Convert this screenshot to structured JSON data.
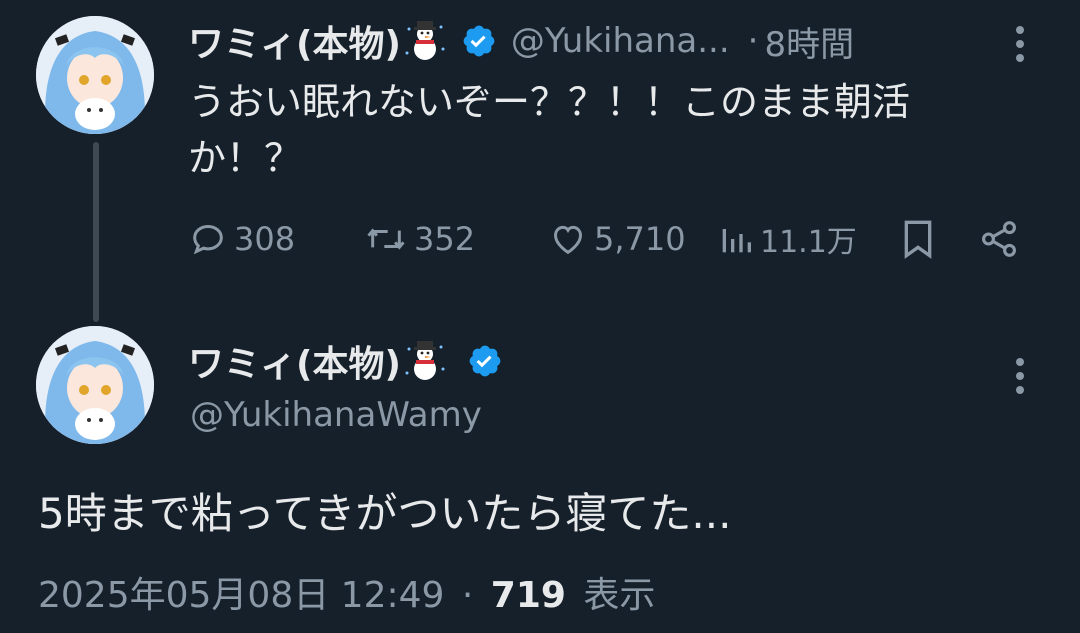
{
  "colors": {
    "background": "#15202b",
    "text": "#e7e9ea",
    "muted": "#8b98a5",
    "verified": "#1d9bf0",
    "thread_line": "#3e4954"
  },
  "tweet1": {
    "display_name": "ワミィ(本物)",
    "name_emoji": "snowman-icon",
    "handle": "@Yukihana...",
    "separator": "·",
    "time": "8時間",
    "text": "うおい眠れないぞー？？！！このまま朝活か！？",
    "actions": {
      "replies": "308",
      "retweets": "352",
      "likes": "5,710",
      "views": "11.1万"
    }
  },
  "tweet2": {
    "display_name": "ワミィ(本物)",
    "name_emoji": "snowman-icon",
    "handle": "@YukihanaWamy",
    "text": "5時まで粘ってきがついたら寝てた...",
    "timestamp": "2025年05月08日 12:49",
    "separator": "·",
    "views_count": "719",
    "views_label": "表示"
  }
}
